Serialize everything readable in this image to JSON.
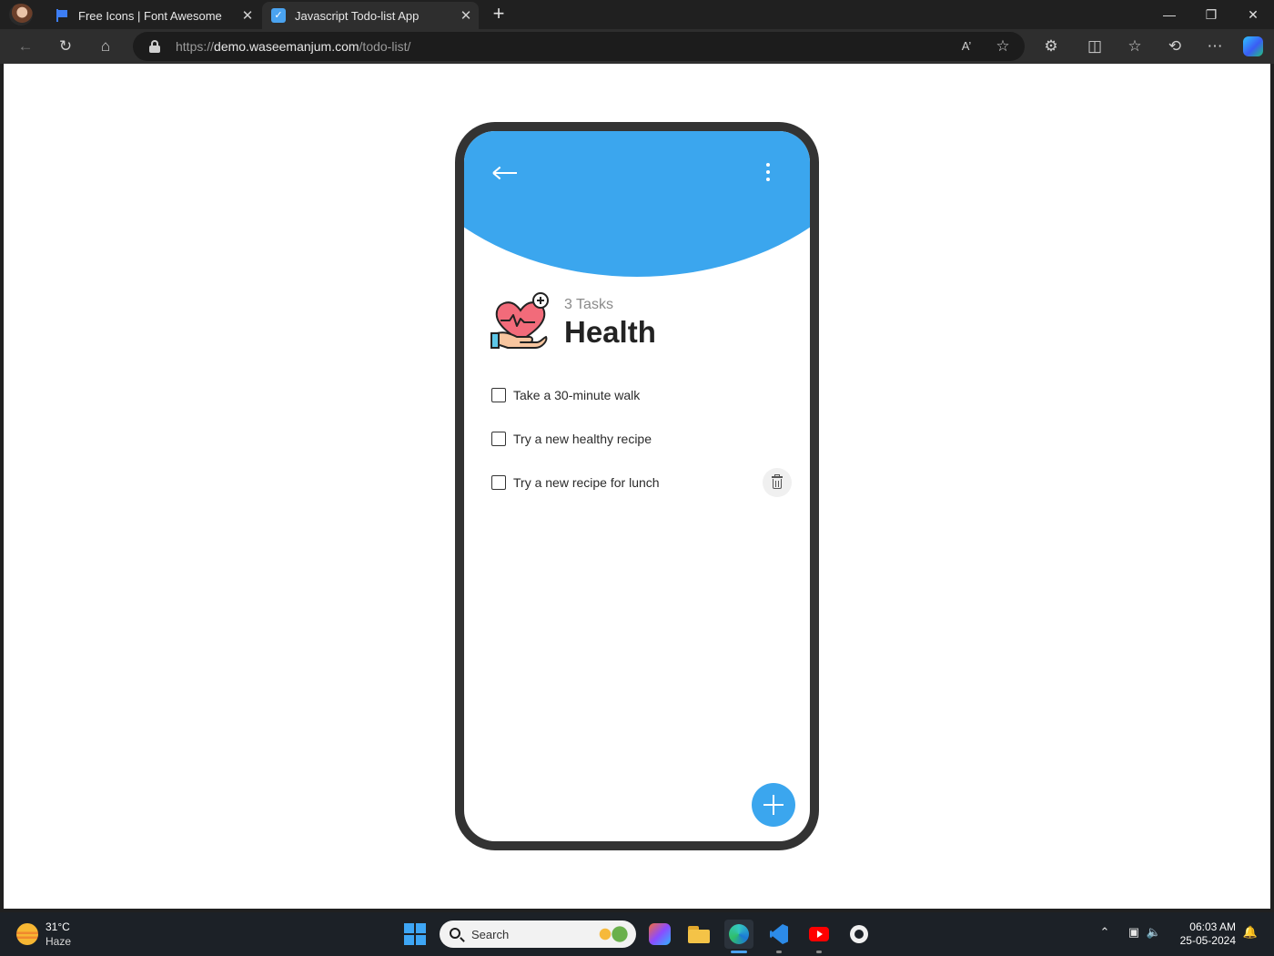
{
  "browser": {
    "tabs": [
      {
        "title": "Free Icons | Font Awesome",
        "active": false
      },
      {
        "title": "Javascript Todo-list App",
        "active": true
      }
    ],
    "url": {
      "scheme": "https://",
      "host": "demo.waseemanjum.com",
      "path": "/todo-list/"
    },
    "icons": {
      "back": "arrow-left-icon",
      "reload": "reload-icon",
      "home": "home-icon",
      "read_aloud": "read-aloud-icon",
      "favorite": "star-icon",
      "extensions": "puzzle-icon",
      "split_screen": "split-screen-icon",
      "favorites": "favorites-icon",
      "history": "history-icon",
      "more": "more-icon",
      "copilot": "copilot-icon"
    }
  },
  "app": {
    "accent_color": "#3ba6ee",
    "category": {
      "task_count_label": "3 Tasks",
      "title": "Health",
      "icon": "heart-in-hand-icon"
    },
    "todos": [
      {
        "text": "Take a 30-minute walk",
        "checked": false
      },
      {
        "text": "Try a new healthy recipe",
        "checked": false
      },
      {
        "text": "Try a new recipe for lunch",
        "checked": false,
        "show_delete": true
      }
    ]
  },
  "taskbar": {
    "weather": {
      "temp": "31°C",
      "condition": "Haze"
    },
    "search_placeholder": "Search",
    "clock": {
      "time": "06:03 AM",
      "date": "25-05-2024"
    },
    "pinned_apps": [
      "microsoft-365-icon",
      "file-explorer-icon",
      "edge-icon",
      "vscode-icon",
      "youtube-icon",
      "github-icon"
    ]
  }
}
